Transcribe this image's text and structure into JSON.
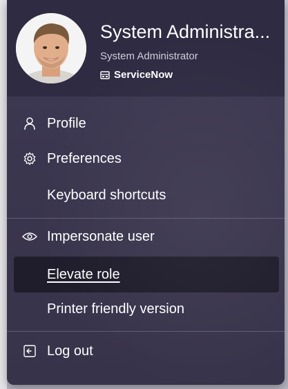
{
  "user": {
    "name": "System Administra...",
    "title": "System Administrator",
    "company": "ServiceNow"
  },
  "menu": {
    "items": [
      {
        "label": "Profile",
        "icon": "person-icon"
      },
      {
        "label": "Preferences",
        "icon": "gear-icon"
      },
      {
        "label": "Keyboard shortcuts",
        "icon": ""
      },
      {
        "label": "Impersonate user",
        "icon": "eye-icon"
      },
      {
        "label": "Elevate role",
        "icon": "",
        "active": true
      },
      {
        "label": "Printer friendly version",
        "icon": ""
      },
      {
        "label": "Log out",
        "icon": "logout-icon"
      }
    ]
  },
  "colors": {
    "menu_background": "#3b364f",
    "header_background": "#2f2b42",
    "active_item": "#1f1d2c",
    "text": "#ffffff"
  }
}
